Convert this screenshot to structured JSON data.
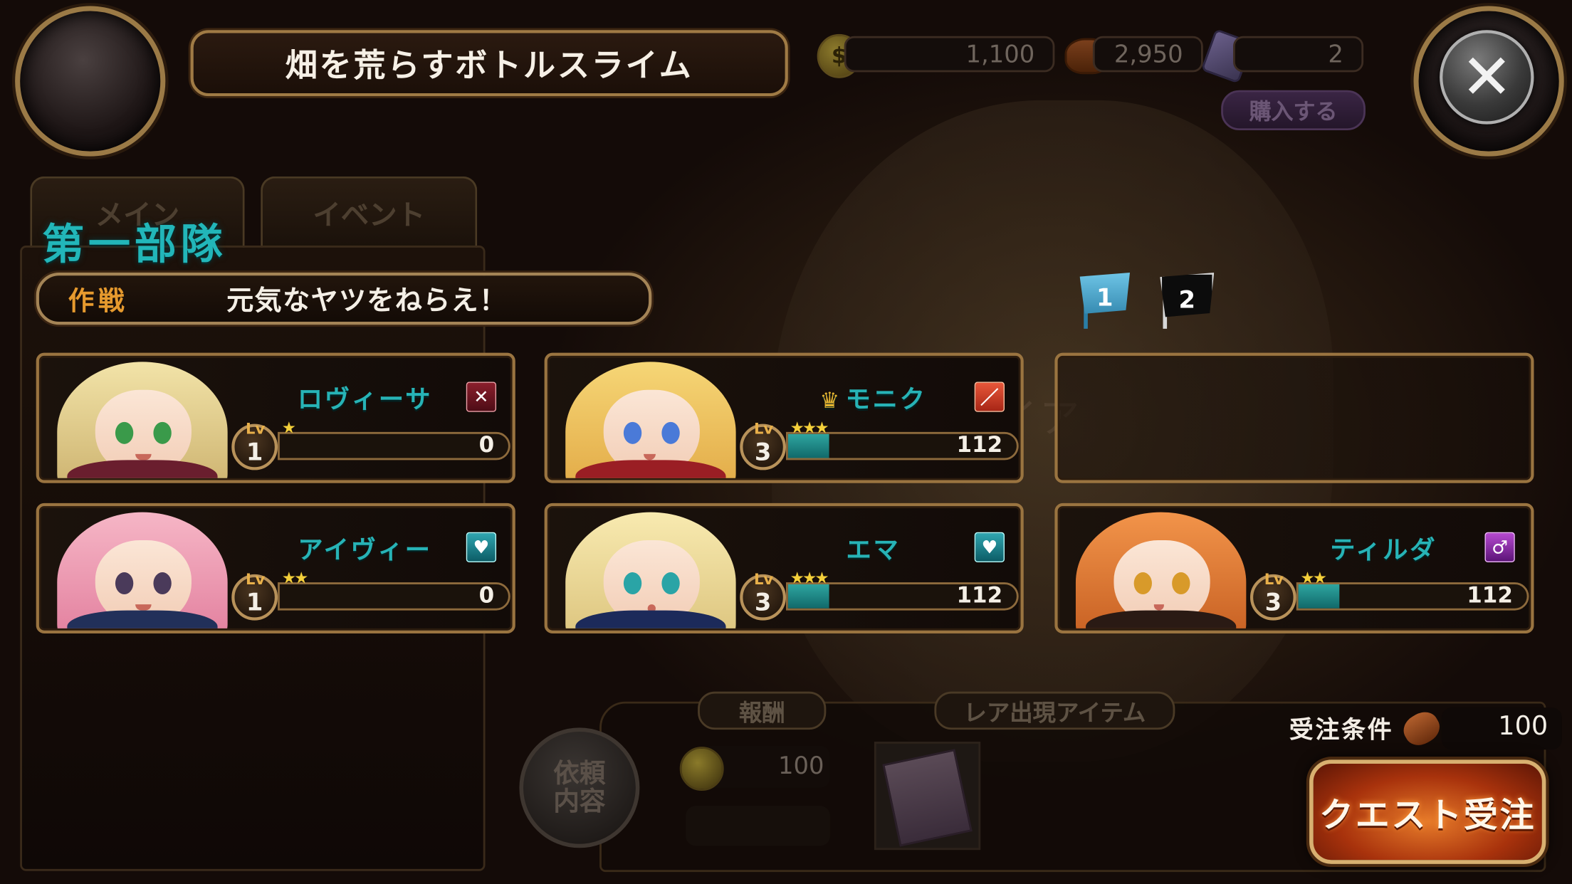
{
  "header": {
    "title": "畑を荒らすボトルスライム",
    "close_label": "✕"
  },
  "resources": {
    "coin": "1,100",
    "bread": "2,950",
    "crystal": "2",
    "buy_label": "購入する"
  },
  "tabs": [
    "メイン",
    "イベント"
  ],
  "squad": {
    "title": "第一部隊",
    "strategy_label": "作戦",
    "strategy_value": "元気なヤツをねらえ！"
  },
  "flags": [
    "1",
    "2"
  ],
  "map": {
    "watermark": "ルカレイア"
  },
  "characters": [
    {
      "name": "ロヴィーサ",
      "lv_tag": "Lv",
      "level": "1",
      "stars": "★",
      "exp": "0",
      "exp_fill": 0.0,
      "class_icon": "sword-icon",
      "leader": false
    },
    {
      "name": "モニク",
      "lv_tag": "Lv",
      "level": "3",
      "stars": "★★★",
      "exp": "112",
      "exp_fill": 0.18,
      "class_icon": "red-blade-icon",
      "leader": true
    },
    {
      "name": "アイヴィー",
      "lv_tag": "Lv",
      "level": "1",
      "stars": "★★",
      "exp": "0",
      "exp_fill": 0.0,
      "class_icon": "heart-shield-icon",
      "leader": false
    },
    {
      "name": "エマ",
      "lv_tag": "Lv",
      "level": "3",
      "stars": "★★★",
      "exp": "112",
      "exp_fill": 0.18,
      "class_icon": "heart-shield-icon",
      "leader": false
    },
    {
      "name": "ティルダ",
      "lv_tag": "Lv",
      "level": "3",
      "stars": "★★",
      "exp": "112",
      "exp_fill": 0.18,
      "class_icon": "magic-icon",
      "leader": false
    }
  ],
  "reward": {
    "tab_reward": "報酬",
    "tab_rare": "レア出現アイテム",
    "request_label": "依頼内容",
    "coin_amount": "100"
  },
  "order": {
    "label": "受注条件",
    "value": "100",
    "button": "クエスト受注"
  },
  "colors": {
    "accent_teal": "#27b3b6",
    "gold_frame": "#9a7440",
    "quest_orange": "#e77b2a"
  }
}
